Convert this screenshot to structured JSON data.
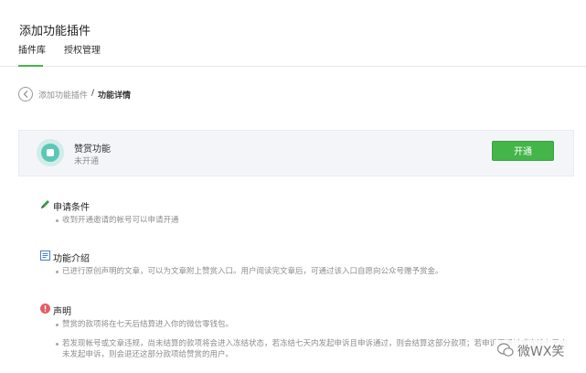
{
  "header": {
    "title": "添加功能插件",
    "tabs": [
      {
        "label": "插件库",
        "active": true
      },
      {
        "label": "授权管理",
        "active": false
      }
    ]
  },
  "breadcrumb": {
    "parent": "添加功能插件",
    "separator": "/",
    "current": "功能详情"
  },
  "plugin": {
    "name": "赞赏功能",
    "status": "未开通",
    "enable_label": "开通"
  },
  "sections": {
    "conditions": {
      "title": "申请条件",
      "icon": "pencil-icon",
      "items": [
        "收到开通邀请的帐号可以申请开通"
      ]
    },
    "intro": {
      "title": "功能介绍",
      "icon": "document-icon",
      "items": [
        "已进行原创声明的文章，可以为文章附上赞赏入口。用户阅读完文章后，可通过该入口自愿向公众号赠予赏金。"
      ]
    },
    "statement": {
      "title": "声明",
      "icon": "warning-icon",
      "items": [
        "赞赏的款项将在七天后结算进入你的微信零钱包。",
        "若发现帐号或文章违规，尚未结算的款项将会进入冻结状态，若冻结七天内发起申诉且申诉通过，则会结算这部分款项；若申诉不通过或冻结七天内未发起申诉，则会退还这部分款项给赞赏的用户。"
      ]
    }
  },
  "watermark": {
    "text": "微WX笑"
  },
  "colors": {
    "accent": "#44b549",
    "warning": "#e15f63",
    "plugin_icon": "#5cc7b6",
    "card_bg": "#f4f5f9"
  }
}
